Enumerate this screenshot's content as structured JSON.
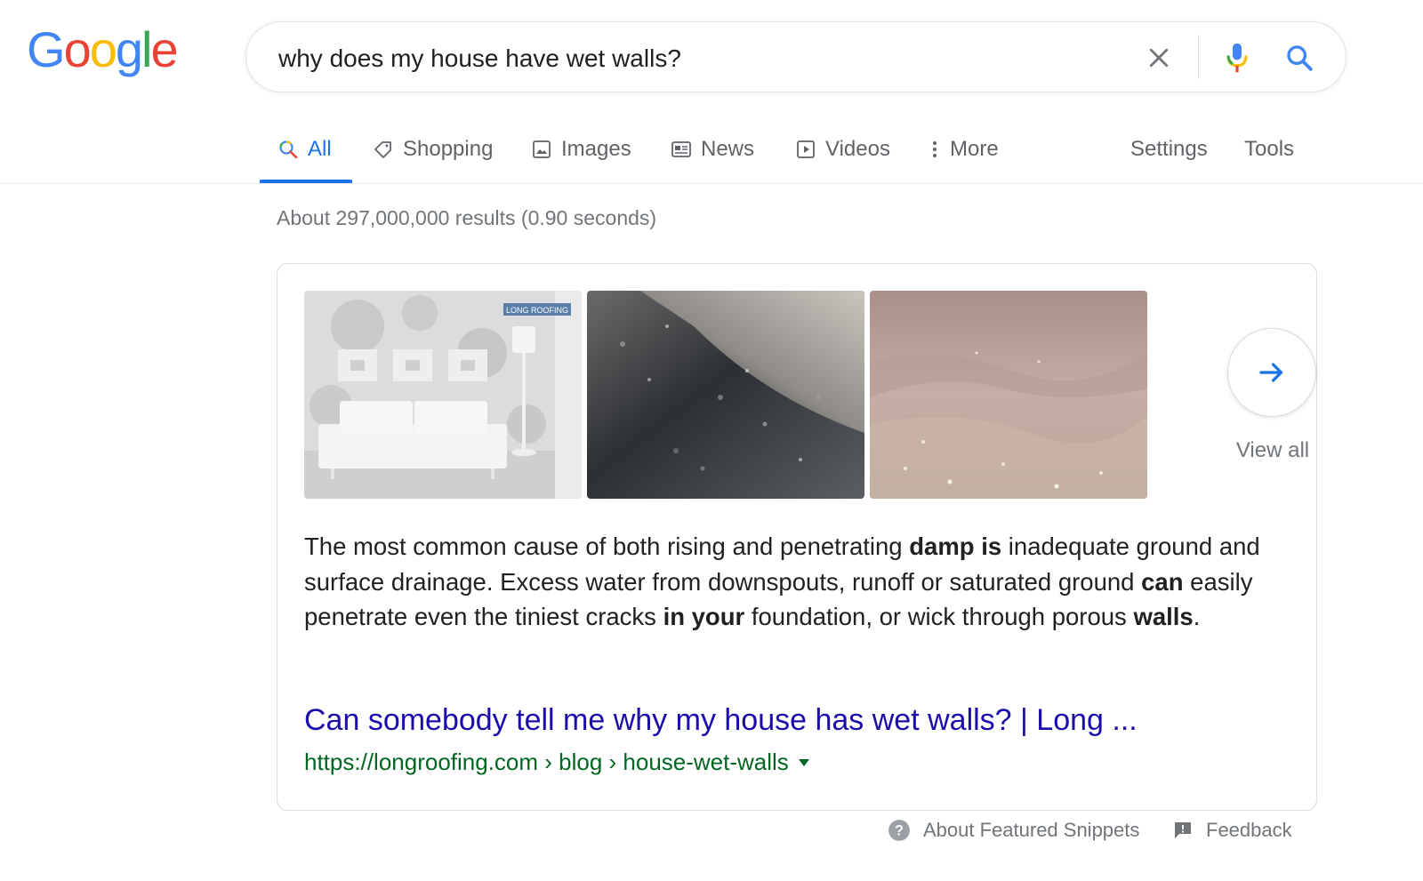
{
  "logo": {
    "letters": [
      "G",
      "o",
      "o",
      "g",
      "l",
      "e"
    ],
    "colors": [
      "#4285F4",
      "#EA4335",
      "#FBBC05",
      "#4285F4",
      "#34A853",
      "#EA4335"
    ]
  },
  "search": {
    "query": "why does my house have wet walls?",
    "icons": [
      "clear-icon",
      "microphone-icon",
      "search-icon"
    ]
  },
  "tabs": [
    {
      "label": "All",
      "icon": "search-icon",
      "active": true
    },
    {
      "label": "Shopping",
      "icon": "tag-icon"
    },
    {
      "label": "Images",
      "icon": "image-icon"
    },
    {
      "label": "News",
      "icon": "news-icon"
    },
    {
      "label": "Videos",
      "icon": "video-icon"
    },
    {
      "label": "More",
      "icon": "more-vert-icon"
    },
    {
      "label": "Settings"
    },
    {
      "label": "Tools"
    }
  ],
  "stats": "About 297,000,000 results (0.90 seconds)",
  "snippet": {
    "images": [
      "living-room-illustration",
      "damp-wall-closeup",
      "wet-surface-closeup"
    ],
    "image_watermark": "LONG ROOFING",
    "view_all_label": "View all",
    "text_parts": [
      {
        "text": "The most common cause of both rising and penetrating ",
        "bold": false
      },
      {
        "text": "damp is",
        "bold": true
      },
      {
        "text": " inadequate ground and surface drainage. Excess water from downspouts, runoff or saturated ground ",
        "bold": false
      },
      {
        "text": "can",
        "bold": true
      },
      {
        "text": " easily penetrate even the tiniest cracks ",
        "bold": false
      },
      {
        "text": "in your",
        "bold": true
      },
      {
        "text": " foundation, or wick through porous ",
        "bold": false
      },
      {
        "text": "walls",
        "bold": true
      },
      {
        "text": ".",
        "bold": false
      }
    ],
    "result_title": "Can somebody tell me why my house has wet walls? | Long ...",
    "result_url": "https://longroofing.com › blog › house-wet-walls"
  },
  "footer": {
    "about_label": "About Featured Snippets",
    "feedback_label": "Feedback"
  },
  "colors": {
    "accent": "#1a73e8",
    "link": "#1a0dab",
    "url": "#006621",
    "muted": "#70757a"
  }
}
